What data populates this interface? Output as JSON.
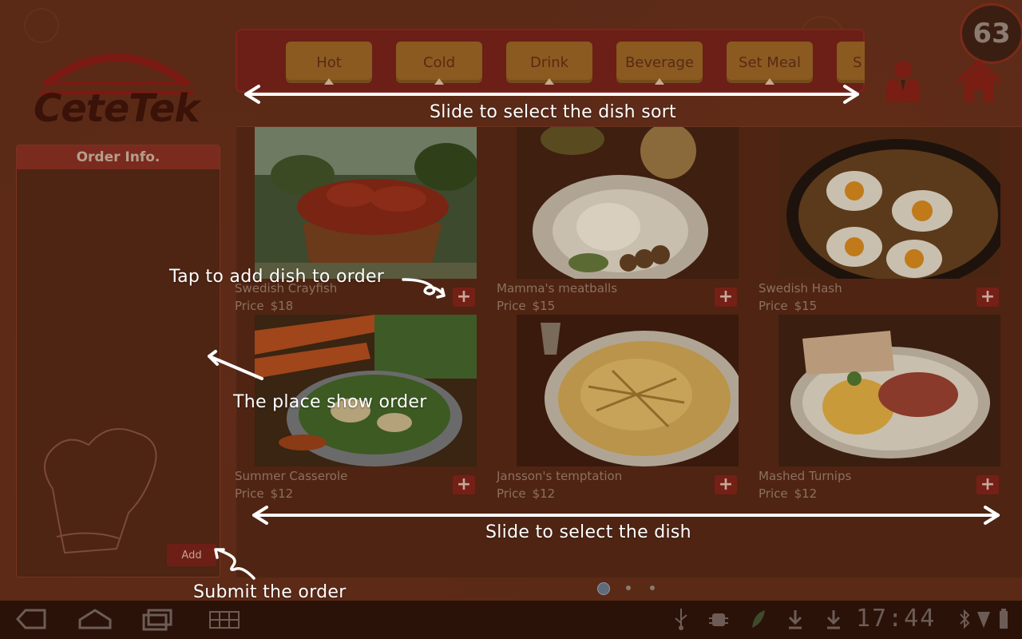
{
  "app": {
    "logo_text": "CeteTek",
    "counter": "63"
  },
  "categories": [
    {
      "label": "Hot"
    },
    {
      "label": "Cold"
    },
    {
      "label": "Drink"
    },
    {
      "label": "Beverage"
    },
    {
      "label": "Set Meal"
    },
    {
      "label": "S"
    }
  ],
  "order_panel": {
    "title": "Order Info.",
    "add_label": "Add"
  },
  "dishes": [
    {
      "name": "Swedish Crayfish",
      "price_label": "Price",
      "price": "$18",
      "photo": "crayfish"
    },
    {
      "name": "Mamma's meatballs",
      "price_label": "Price",
      "price": "$15",
      "photo": "meatballs"
    },
    {
      "name": "Swedish Hash",
      "price_label": "Price",
      "price": "$15",
      "photo": "hash"
    },
    {
      "name": "Summer Casserole",
      "price_label": "Price",
      "price": "$12",
      "photo": "casserole"
    },
    {
      "name": "Jansson's temptation",
      "price_label": "Price",
      "price": "$12",
      "photo": "gratin"
    },
    {
      "name": "Mashed Turnips",
      "price_label": "Price",
      "price": "$12",
      "photo": "turnips"
    }
  ],
  "add_dish_symbol": "+",
  "annotations": {
    "slide_sort": "Slide to select the dish sort",
    "tap_add": "Tap to add dish to order",
    "order_place": "The place show order",
    "slide_dish": "Slide to select the dish",
    "submit": "Submit the order"
  },
  "pager": {
    "pages": 3,
    "current": 1
  },
  "system_bar": {
    "clock": "17:44",
    "icons": [
      "back-icon",
      "home-icon",
      "recent-apps-icon",
      "menu-grid-icon",
      "usb-icon",
      "android-debug-icon",
      "leaf-icon",
      "download-icon",
      "download-icon",
      "bluetooth-icon",
      "wifi-icon",
      "battery-icon"
    ]
  },
  "colors": {
    "background": "#5a2a17",
    "accent": "#7b2a1e",
    "category_button": "#8a5a21",
    "annotation_text": "#ffffff"
  }
}
